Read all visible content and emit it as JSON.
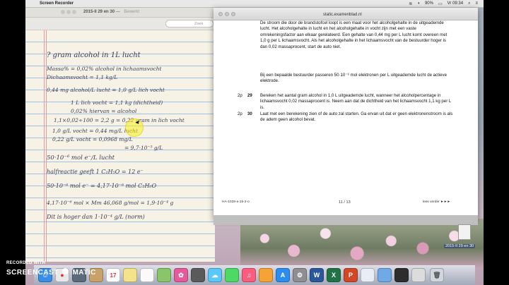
{
  "menubar": {
    "app_name": "Screen Recorder",
    "battery": "90%",
    "clock": "Vr 09:34"
  },
  "notes_window": {
    "title": "2015-II 29 en 30",
    "subtitle": "Bewerkt",
    "search_placeholder": "Zoek",
    "handwriting": [
      "? gram alcohol in 1L lucht",
      "Massa% = 0,02% alcohol in lichaamsvocht",
      "Dichaamsvocht = 1,1 kg/L",
      "0,44 mg alcohol/L lucht = 1,0 g/L lich vocht",
      "1 L lich vocht = 1,1 kg (dichtheid)",
      "0,02% hiervan = alcohol",
      "1,1×0,02÷100 = 2,2 g = 0,22 gram in lich vocht",
      "1,0 g/L vocht = 0,44 mg/L lucht",
      "0,22 g/L vocht = 0,0968 mg/L",
      "= 9,7·10⁻⁵ g/L",
      "50·10⁻⁶ mol e⁻/L lucht",
      "halfreactie geeft 1 C₂H₅O = 12 e⁻",
      "50·10⁻⁶ mol e⁻ = 4,17·10⁻⁶ mol C₂H₆O",
      "4,17·10⁻⁶ mol × Mm 46,068 g/mol = 1,9·10⁻⁴ g",
      "Dit is hoger dan 1·10⁻⁴ g/L (norm)"
    ]
  },
  "exam_window": {
    "url": "static.examenblad.nl",
    "paragraph1": "De stroom die door de brandstofcel loopt is een maat voor het alcoholgehalte in de uitgeademde lucht. Het alcoholgehalte in lucht en het alcoholgehalte in vocht zijn met een vaste omrekeningsfactor aan elkaar gerelateerd. Een gehalte van 0,44 mg per L lucht komt overeen met 1,0 g per L lichaamsvocht. Als het alcoholgehalte in het lichaamsvocht van de bestuurder hoger is dan 0,02 massaprocent, start de auto niet.",
    "paragraph2": "Bij een bepaalde bestuurder passeren 50·10⁻⁶ mol elektronen per L uitgeademde lucht de actieve elektrode.",
    "questions": [
      {
        "points": "2p",
        "number": "29",
        "text": "Bereken het aantal gram alcohol in 1,0 L uitgeademde lucht, wanneer het alcoholpercentage in lichaamsvocht 0,02 massaprocent is. Neem aan dat de dichtheid van het lichaamsvocht 1,1 kg per L is."
      },
      {
        "points": "2p",
        "number": "30",
        "text": "Laat met een berekening zien of de auto zal starten. Ga ervan uit dat er geen elektronenstroom is als de adem geen alcohol bevat."
      }
    ],
    "footer_left": "HA-1028-a-15-2-o",
    "page": "11 / 13",
    "footer_right": "lees verder ►►►"
  },
  "desktop": {
    "file_label": "2015-II 29 en 30"
  },
  "recorder_watermark": {
    "line1": "RECORDED WITH",
    "line2": "SCREENCAST",
    "line3": "MATIC"
  },
  "dock": {
    "items": [
      "finder",
      "chrome",
      "photos",
      "contacts",
      "calendar",
      "notes",
      "reminders",
      "maps",
      "photo-booth",
      "messages",
      "facetime",
      "itunes",
      "ibooks",
      "app-store",
      "preferences",
      "word",
      "excel",
      "powerpoint",
      "preview",
      "finder-folder",
      "quicktime",
      "trash"
    ]
  },
  "colors": {
    "ruled_line": "#9fc1e3",
    "margin_line": "#e59aa0",
    "ink": "#3c3a55",
    "highlight": "#faf01e"
  }
}
